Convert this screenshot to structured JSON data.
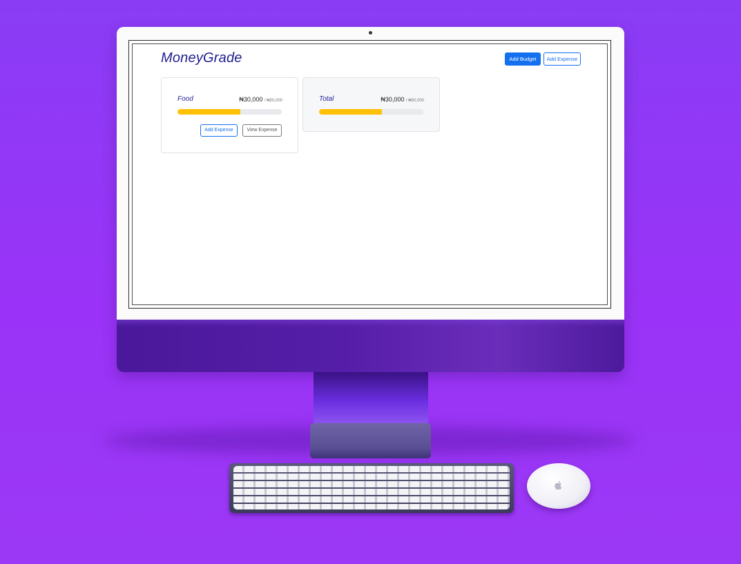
{
  "app": {
    "title": "MoneyGrade"
  },
  "header": {
    "add_budget_label": "Add Budget",
    "add_expense_label": "Add Expense"
  },
  "budgets": [
    {
      "name": "Food",
      "amount": "₦30,000",
      "max": "/ ₦50,000",
      "progress": 0.6,
      "add_expense_label": "Add Expense",
      "view_expense_label": "View Expense"
    }
  ],
  "total": {
    "name": "Total",
    "amount": "₦30,000",
    "max": "/ ₦50,000",
    "progress": 0.6
  },
  "colors": {
    "brand_blue": "#1570ef",
    "title_navy": "#1d1d8f",
    "progress_yellow": "#ffc107",
    "background_purple": "#9633f6"
  },
  "icons": {
    "mouse_logo": "apple-logo-icon",
    "camera": "camera-icon"
  }
}
